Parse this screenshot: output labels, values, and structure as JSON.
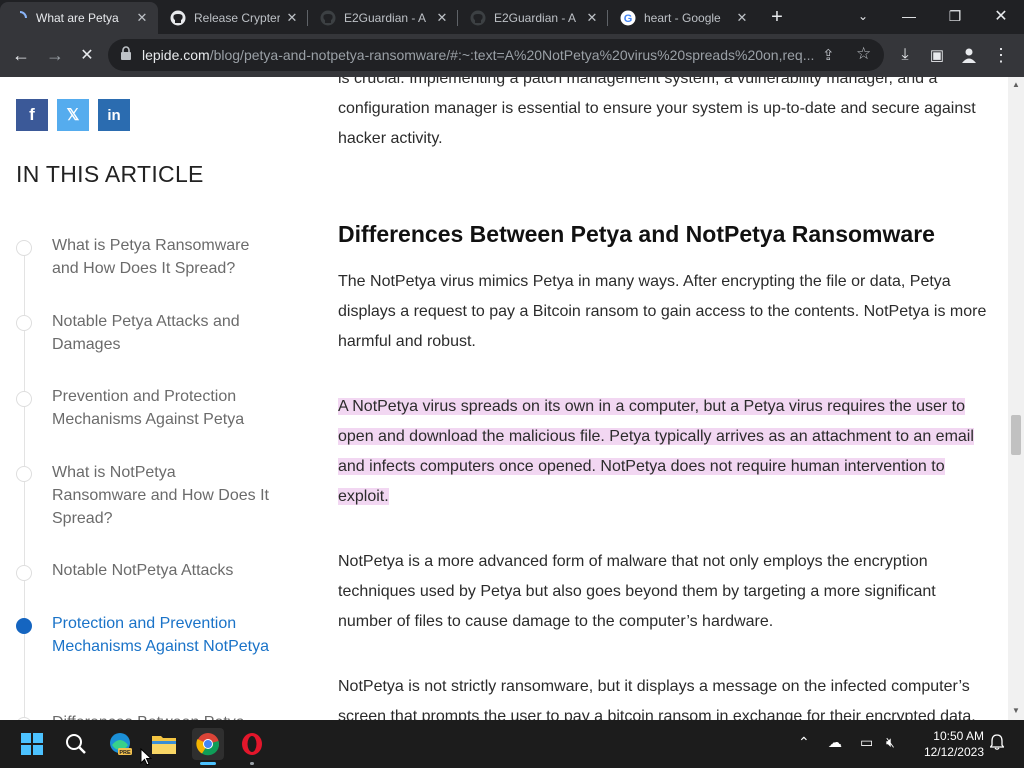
{
  "browser": {
    "tabs": [
      {
        "title": "What are Petya",
        "active": true
      },
      {
        "title": "Release Crypter",
        "active": false
      },
      {
        "title": "E2Guardian - A",
        "active": false
      },
      {
        "title": "E2Guardian - A",
        "active": false
      },
      {
        "title": "heart - Google",
        "active": false
      }
    ],
    "url_host": "lepide.com",
    "url_path": "/blog/petya-and-notpetya-ransomware/#:~:text=A%20NotPetya%20virus%20spreads%20on,req..."
  },
  "sidebar": {
    "social": [
      {
        "label": "f",
        "color": "#3b5998"
      },
      {
        "label": "𝕏",
        "color": "#55acee"
      },
      {
        "label": "in",
        "color": "#2b6cb0"
      }
    ],
    "heading": "IN THIS ARTICLE",
    "toc": [
      {
        "label": "What is Petya Ransomware and How Does It Spread?",
        "active": false
      },
      {
        "label": "Notable Petya Attacks and Damages",
        "active": false
      },
      {
        "label": "Prevention and Protection Mechanisms Against Petya",
        "active": false
      },
      {
        "label": "What is NotPetya Ransomware and How Does It Spread?",
        "active": false
      },
      {
        "label": "Notable NotPetya Attacks",
        "active": false
      },
      {
        "label": "Protection and Prevention Mechanisms Against NotPetya",
        "active": true
      },
      {
        "label": "Differences Between Petya",
        "active": false
      }
    ]
  },
  "article": {
    "intro": "is crucial. Implementing a patch management system, a vulnerability manager, and a configuration manager is essential to ensure your system is up-to-date and secure against hacker activity.",
    "heading": "Differences Between Petya and NotPetya Ransomware",
    "p1": "The NotPetya virus mimics Petya in many ways. After encrypting the file or data, Petya displays a request to pay a Bitcoin ransom to gain access to the contents. NotPetya is more harmful and robust.",
    "p2": "A NotPetya virus spreads on its own in a computer, but a Petya virus requires the user to open and download the malicious file. Petya typically arrives as an attachment to an email and infects computers once opened. NotPetya does not require human intervention to exploit.",
    "p3": "NotPetya is a more advanced form of malware that not only employs the encryption techniques used by Petya but also goes beyond them by targeting a more significant number of files to cause damage to the computer’s hardware.",
    "p4": "NotPetya is not strictly ransomware, but it displays a message on the infected computer’s screen that prompts the user to pay a bitcoin ransom in exchange for their encrypted data."
  },
  "taskbar": {
    "time": "10:50 AM",
    "date": "12/12/2023"
  }
}
